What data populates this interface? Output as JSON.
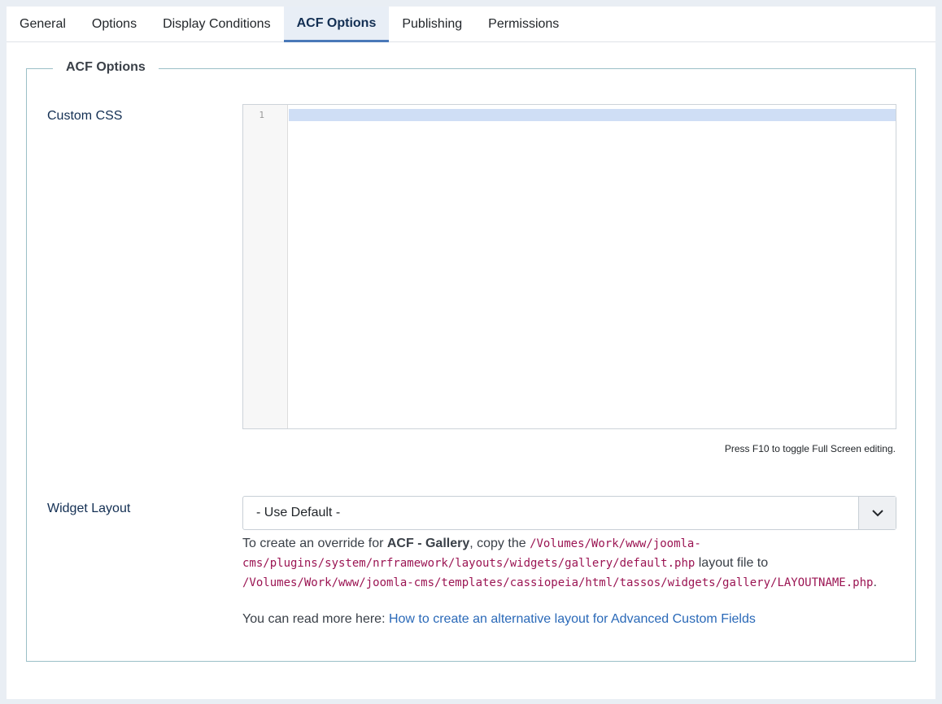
{
  "tabs": [
    {
      "label": "General"
    },
    {
      "label": "Options"
    },
    {
      "label": "Display Conditions"
    },
    {
      "label": "ACF Options",
      "active": true
    },
    {
      "label": "Publishing"
    },
    {
      "label": "Permissions"
    }
  ],
  "fieldset": {
    "legend": "ACF Options"
  },
  "custom_css": {
    "label": "Custom CSS",
    "line_number": "1",
    "hint": "Press F10 to toggle Full Screen editing."
  },
  "widget_layout": {
    "label": "Widget Layout",
    "selected": "- Use Default -",
    "desc": {
      "pre": "To create an override for ",
      "widget_name": "ACF - Gallery",
      "mid1": ", copy the ",
      "source_path_1": "/Volumes/Work/www/joomla-",
      "source_path_2": "cms/plugins/system/nrframework/layouts/widgets/gallery/default.php",
      "mid2": " layout file to",
      "target_path": "/Volumes/Work/www/joomla-cms/templates/cassiopeia/html/tassos/widgets/gallery/LAYOUTNAME.php",
      "end": "."
    },
    "more_prefix": "You can read more here: ",
    "more_link": "How to create an alternative layout for Advanced Custom Fields"
  },
  "colors": {
    "accent": "#4a79b8",
    "link": "#2a69b8",
    "code": "#9b1553"
  }
}
